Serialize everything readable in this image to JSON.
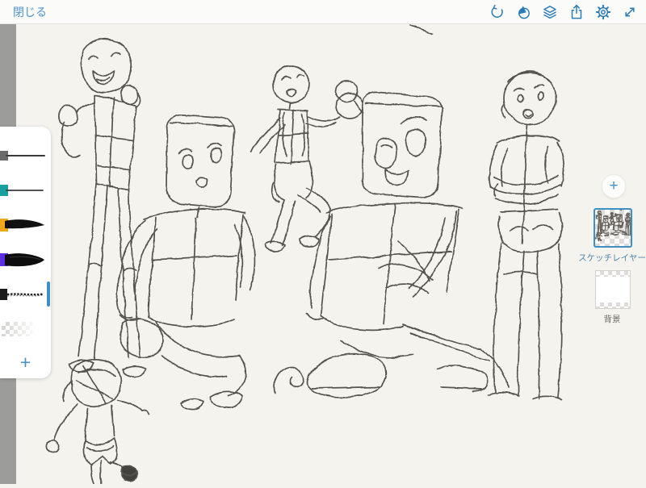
{
  "toolbar": {
    "close_label": "閉じる",
    "icons": [
      {
        "name": "undo-icon"
      },
      {
        "name": "blend-icon"
      },
      {
        "name": "layers-icon"
      },
      {
        "name": "share-icon"
      },
      {
        "name": "settings-icon"
      },
      {
        "name": "fullscreen-icon"
      }
    ]
  },
  "brush_panel": {
    "add_label": "+",
    "brushes": [
      {
        "name": "graphite-pencil",
        "color": "#6b6b6b",
        "selected": false
      },
      {
        "name": "color-pencil",
        "color": "#1a9e9e",
        "selected": false
      },
      {
        "name": "ink-pen",
        "color": "#f2a71b",
        "selected": false
      },
      {
        "name": "paint-brush",
        "color": "#5b2fe0",
        "selected": false
      },
      {
        "name": "sketch-pencil",
        "color": "#1a1a1a",
        "selected": true
      },
      {
        "name": "eraser",
        "color": "",
        "selected": false
      }
    ]
  },
  "layers_panel": {
    "add_label": "+",
    "layers": [
      {
        "label": "スケッチレイヤー",
        "selected": true
      },
      {
        "label": "背景",
        "selected": false
      }
    ]
  },
  "colors": {
    "accent_blue": "#3e8fc4",
    "toolbar_icon_blue": "#2b7cb4",
    "canvas": "#f4f3ee",
    "edge_strip": "#9c9c9a"
  }
}
